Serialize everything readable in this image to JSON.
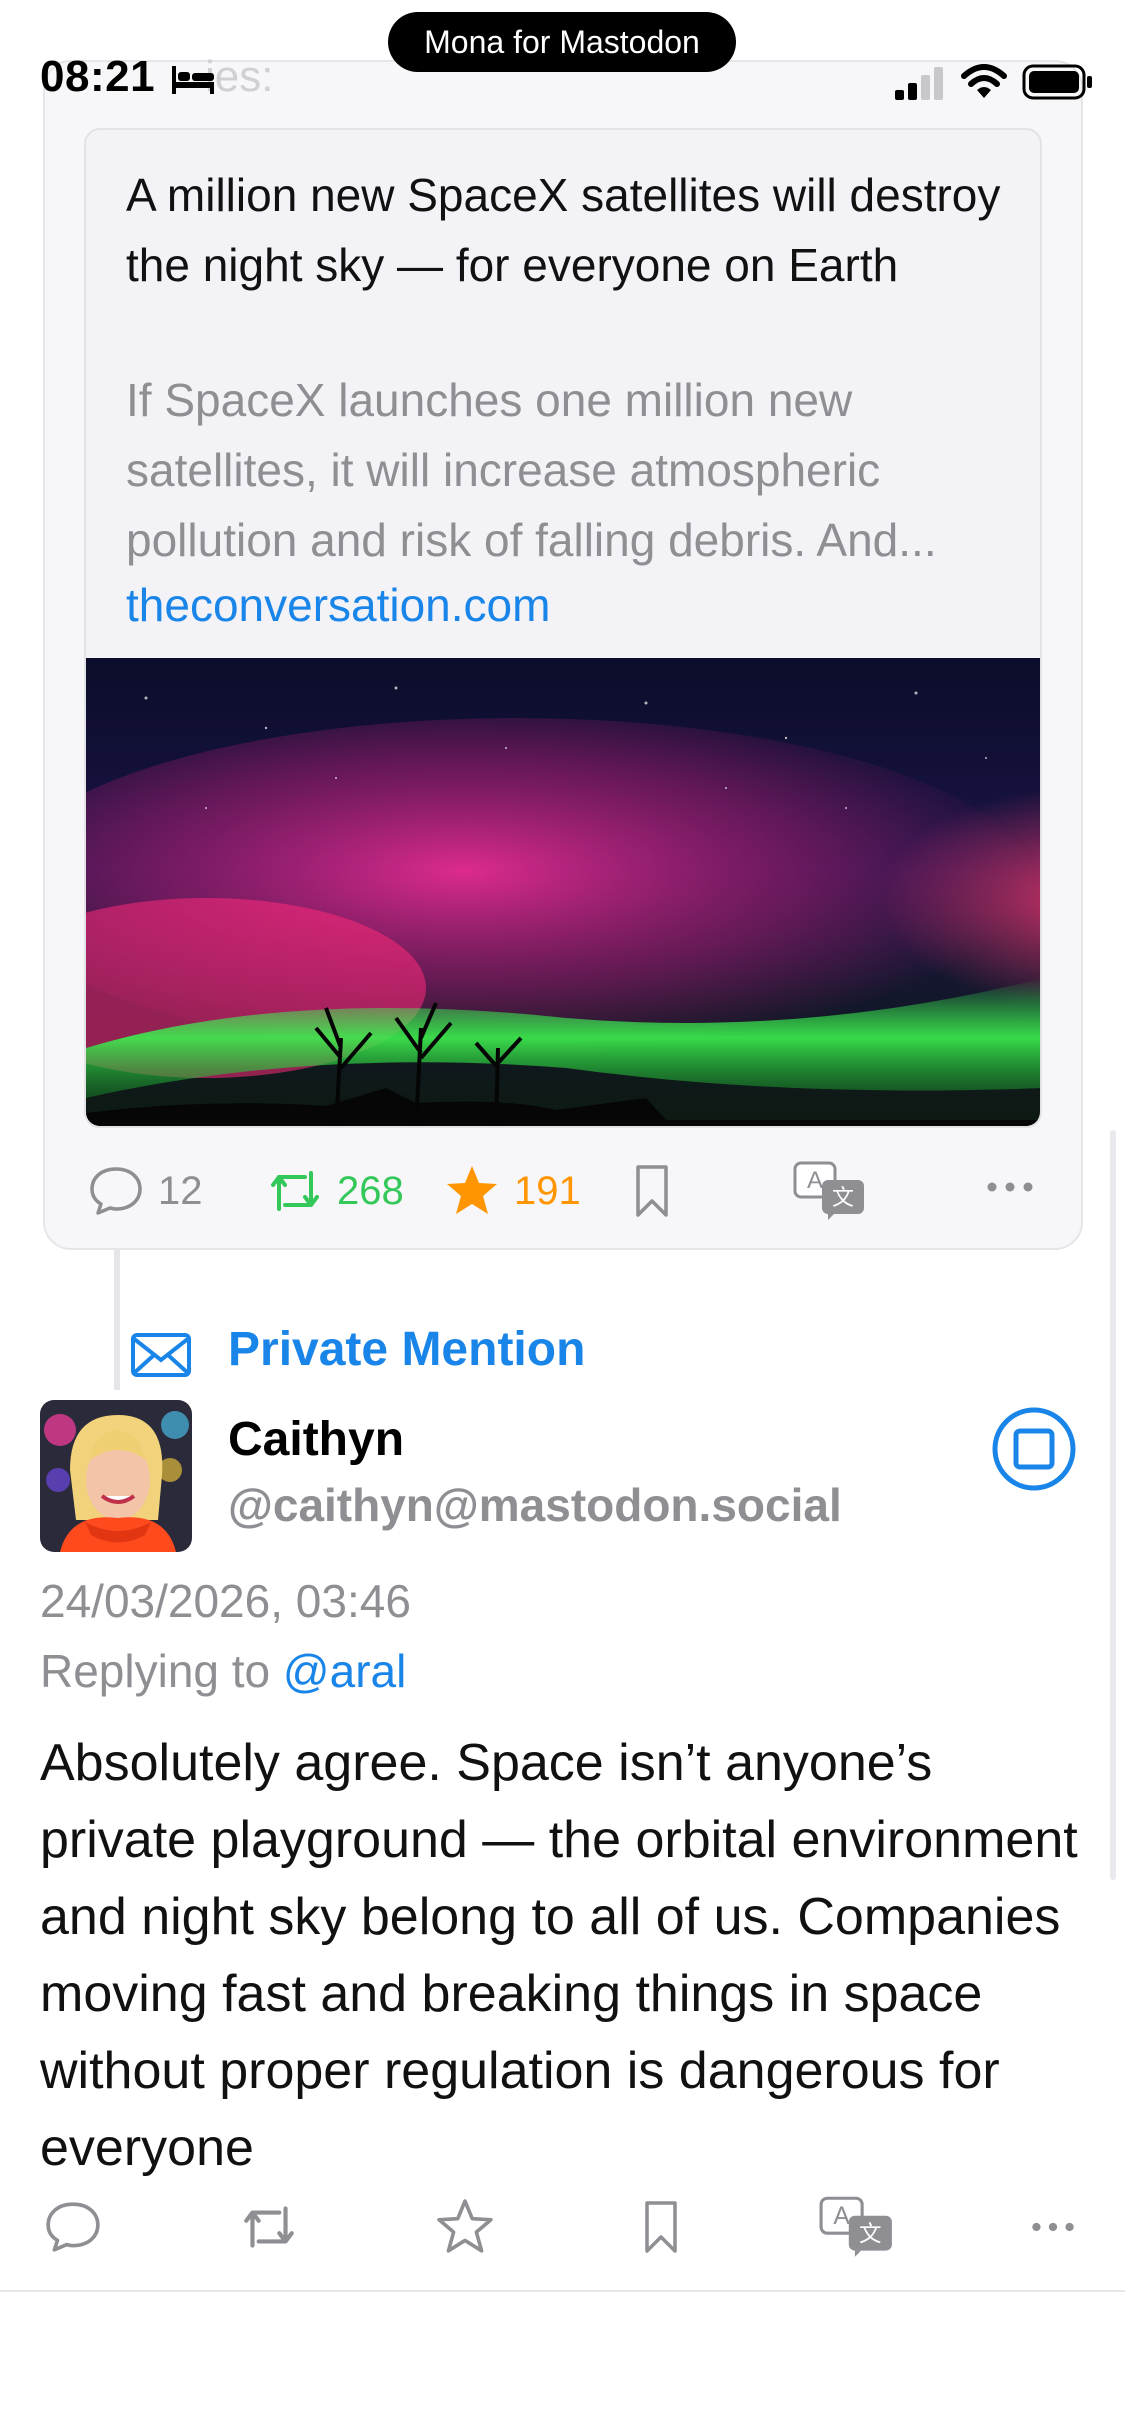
{
  "status_bar": {
    "time": "08:21",
    "ghost_text": "ies:",
    "app_pill": "Mona for Mastodon"
  },
  "quoted_post": {
    "link_card": {
      "title": "A million new SpaceX satellites will destroy the night sky — for everyone on Earth",
      "description": "If SpaceX launches one million new satellites, it will increase atmospheric pollution and risk of falling debris. And...",
      "domain": "theconversation.com"
    },
    "actions": {
      "replies": "12",
      "boosts": "268",
      "favourites": "191"
    }
  },
  "reply_post": {
    "mention_label": "Private Mention",
    "display_name": "Caithyn",
    "handle": "@caithyn@mastodon.social",
    "timestamp": "24/03/2026, 03:46",
    "replying_prefix": "Replying to ",
    "replying_to": "@aral",
    "body": "Absolutely agree. Space isn’t anyone’s private playground — the orbital environment and night sky belong to all of us. Companies moving fast and breaking things in space without proper regulation is dangerous for everyone"
  },
  "colors": {
    "accent_blue": "#1a85e8",
    "boost_green": "#34c759",
    "favourite_orange": "#ff9500",
    "secondary_gray": "#8e8e93"
  },
  "icons": [
    "bed-icon",
    "signal-icon",
    "wifi-icon",
    "battery-icon",
    "reply-icon",
    "boost-icon",
    "star-icon",
    "bookmark-icon",
    "translate-icon",
    "more-icon",
    "envelope-icon",
    "visibility-icon"
  ]
}
